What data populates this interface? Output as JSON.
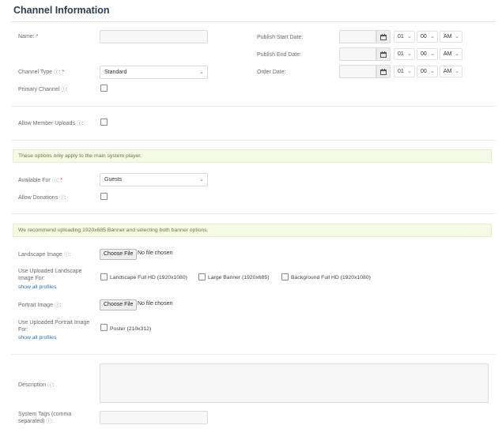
{
  "title": "Channel Information",
  "name": {
    "label": "Name:",
    "required": "*",
    "value": ""
  },
  "publish_start": {
    "label": "Publish Start Date:",
    "hour": "01",
    "minute": "00",
    "ampm": "AM"
  },
  "publish_end": {
    "label": "Publish End Date:",
    "hour": "01",
    "minute": "00",
    "ampm": "AM"
  },
  "order_date": {
    "label": "Order Date:",
    "hour": "01",
    "minute": "00",
    "ampm": "AM"
  },
  "channel_type": {
    "label": "Channel Type",
    "help": "ⓘ",
    "suffix": ":",
    "required": "*",
    "value": "Standard"
  },
  "primary_channel": {
    "label": "Primary Channel",
    "help": "ⓘ",
    "suffix": ":"
  },
  "allow_member_uploads": {
    "label": "Allow Member Uploads",
    "help": "ⓘ",
    "suffix": ":"
  },
  "notice_player": "These options only apply to the main system player.",
  "available_for": {
    "label": "Available For",
    "help": "ⓘ",
    "suffix": ":",
    "required": "*",
    "value": "Guests"
  },
  "allow_donations": {
    "label": "Allow Donations",
    "help": "ⓘ",
    "suffix": ":"
  },
  "notice_banner": "We recommend uploading 1920x685 Banner and selecting both banner options.",
  "landscape_image": {
    "label": "Landscape Image",
    "help": "ⓘ",
    "suffix": ":",
    "button": "Choose File",
    "status": "No file chosen"
  },
  "use_landscape": {
    "label_line1": "Use Uploaded Landscape",
    "label_line2": "Image For:",
    "link": "show all profiles",
    "options": [
      "Landscape Full HD (1920x1080)",
      "Large Banner (1920x685)",
      "Background Full HD (1920x1080)"
    ]
  },
  "portrait_image": {
    "label": "Portrait Image",
    "help": "ⓘ",
    "suffix": ":",
    "button": "Choose File",
    "status": "No file chosen"
  },
  "use_portrait": {
    "label_line1": "Use Uploaded Portrait Image",
    "label_line2": "For:",
    "link": "show all profiles",
    "options": [
      "Poster (210x312)"
    ]
  },
  "description": {
    "label": "Description",
    "help": "ⓘ",
    "suffix": ":"
  },
  "system_tags": {
    "label_line1": "System Tags (comma",
    "label_line2": "separated)",
    "help": "ⓘ",
    "suffix": ":"
  },
  "icons": {
    "calendar": "calendar-icon",
    "chevron": "chevron-down-icon"
  }
}
